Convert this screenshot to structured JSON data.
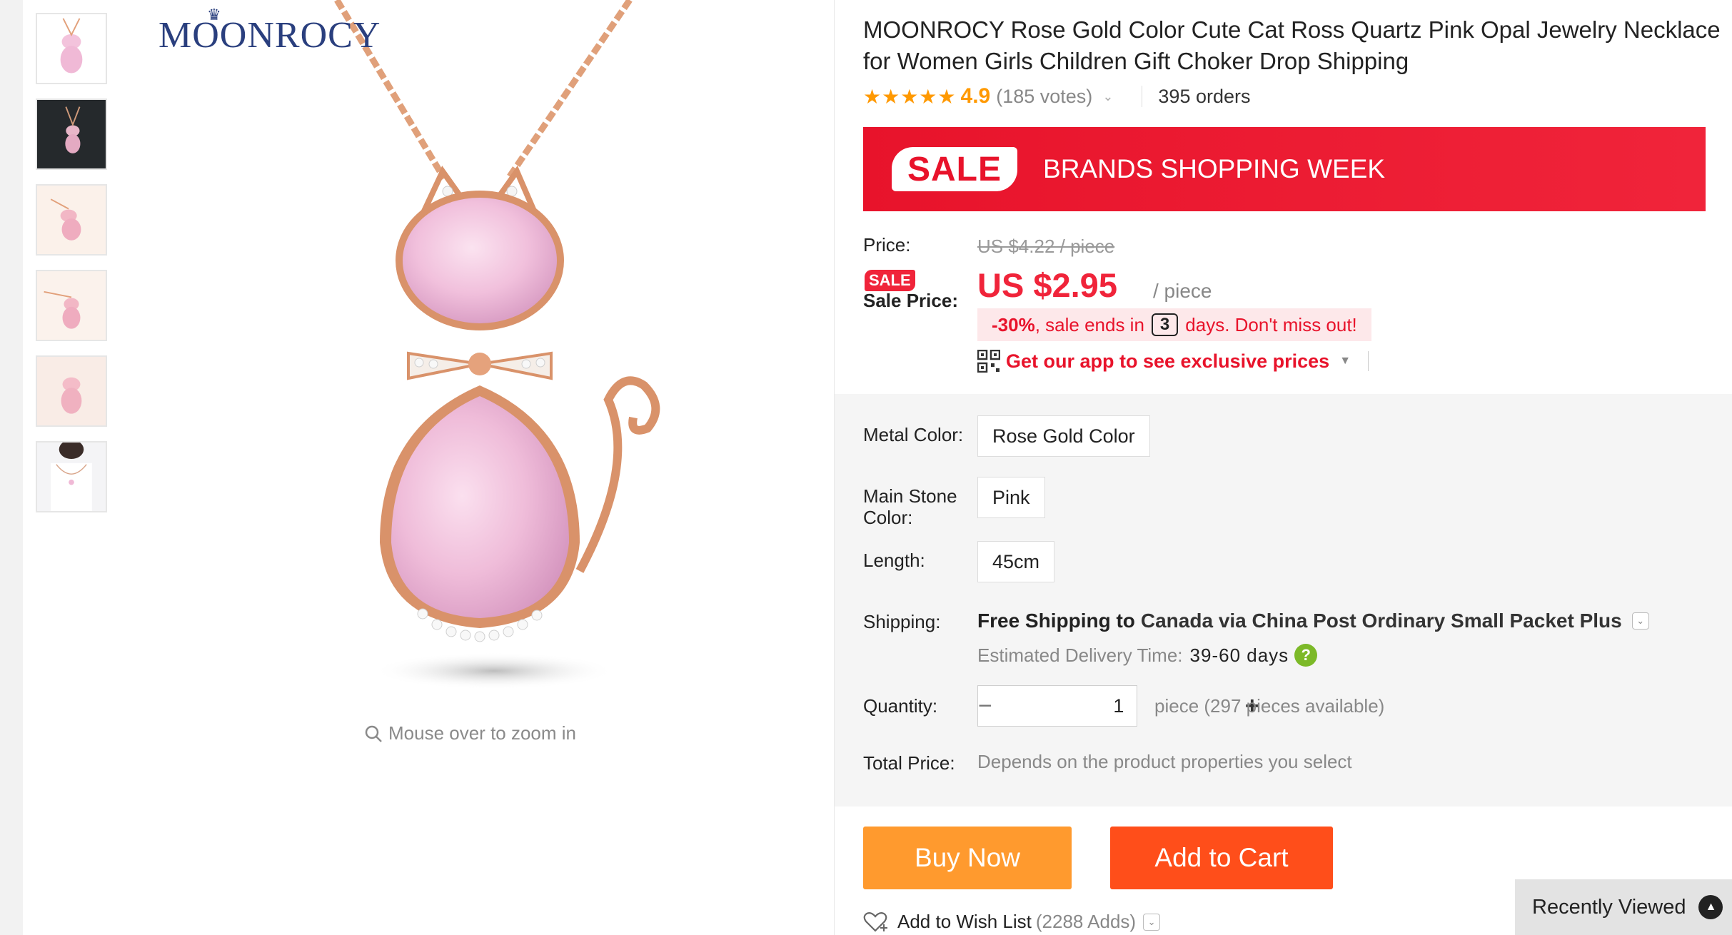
{
  "gallery": {
    "brand_logo": "MOONROCY",
    "zoom_hint": "Mouse over to zoom in",
    "thumbnail_count": 6
  },
  "product": {
    "title": "MOONROCY Rose Gold Color Cute Cat Ross Quartz Pink Opal Jewelry Necklace for Women Girls Children Gift Choker Drop Shipping",
    "stars": "★★★★★",
    "rating": "4.9",
    "votes": "(185 votes)",
    "orders": "395 orders"
  },
  "banner": {
    "badge": "SALE",
    "text": "BRANDS SHOPPING WEEK"
  },
  "pricing": {
    "price_label": "Price:",
    "original_price": "US $4.22 / piece",
    "sale_badge": "SALE",
    "sale_price_label": "Sale Price:",
    "sale_price": "US $2.95",
    "per_piece": "/ piece",
    "discount_pct": "-30%",
    "sale_ends_prefix": ", sale ends in",
    "sale_days": "3",
    "sale_ends_suffix": "days. Don't miss out!",
    "app_promo": "Get our app to see exclusive prices"
  },
  "options": {
    "metal_color_label": "Metal Color:",
    "metal_color_value": "Rose Gold Color",
    "stone_color_label": "Main Stone Color:",
    "stone_color_value": "Pink",
    "length_label": "Length:",
    "length_value": "45cm",
    "shipping_label": "Shipping:",
    "shipping_free": "Free Shipping to",
    "shipping_dest": "Canada via China Post Ordinary Small Packet Plus",
    "delivery_label": "Estimated Delivery Time:",
    "delivery_value": "39-60 days",
    "quantity_label": "Quantity:",
    "quantity_value": "1",
    "quantity_note": "piece (297 pieces available)",
    "total_label": "Total Price:",
    "total_value": "Depends on the product properties you select"
  },
  "actions": {
    "buy_now": "Buy Now",
    "add_to_cart": "Add to Cart",
    "wishlist_label": "Add to Wish List",
    "wishlist_count": "(2288 Adds)"
  },
  "recently_viewed": "Recently Viewed",
  "colors": {
    "accent_red": "#f0243a",
    "buy_now": "#ff9a2e",
    "add_to_cart": "#ff4e1a",
    "rating": "#ff9900",
    "help_green": "#7cb928"
  }
}
